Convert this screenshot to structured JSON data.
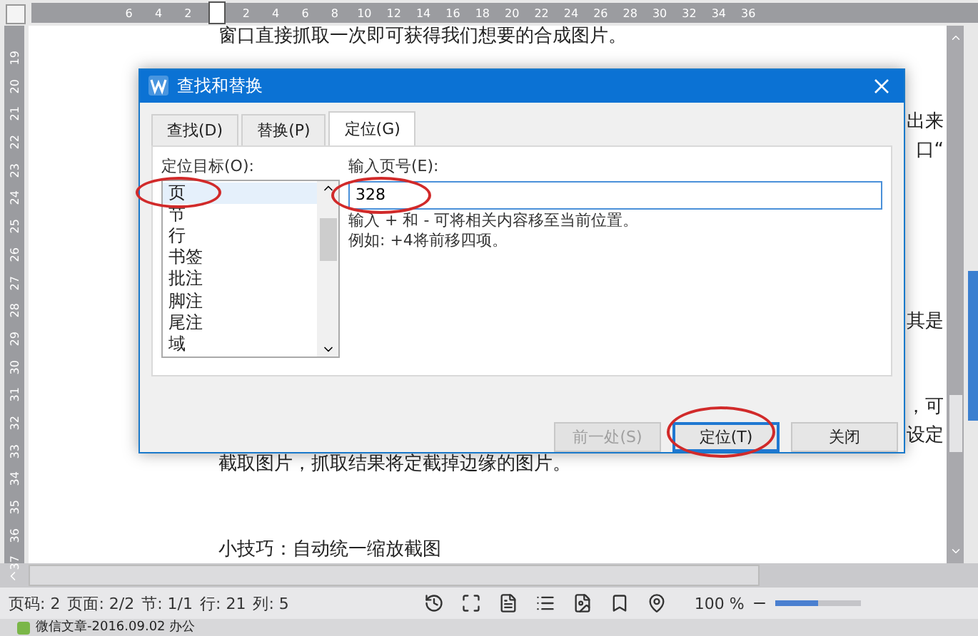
{
  "ruler": {
    "horizontal_ticks": [
      "6",
      "4",
      "2",
      "2",
      "4",
      "6",
      "8",
      "10",
      "12",
      "14",
      "16",
      "18",
      "20",
      "22",
      "24",
      "26",
      "28",
      "30",
      "32",
      "34",
      "36"
    ],
    "vertical_ticks": [
      "19",
      "20",
      "21",
      "22",
      "23",
      "24",
      "25",
      "26",
      "27",
      "28",
      "29",
      "30",
      "31",
      "32",
      "33",
      "34",
      "35",
      "36",
      "37"
    ]
  },
  "document": {
    "lines": [
      {
        "text": "窗口直接抓取一次即可获得我们想要的合成图片。",
        "kind": "body"
      },
      {
        "text": "出来",
        "kind": "fragment"
      },
      {
        "text": "口“",
        "kind": "fragment"
      },
      {
        "text": "其是",
        "kind": "fragment"
      },
      {
        "text": "，可",
        "kind": "fragment"
      },
      {
        "text": "设定",
        "kind": "fragment"
      },
      {
        "text": "截取图片，抓取结果将定截掉边缘的图片。",
        "kind": "body"
      },
      {
        "text": "小技巧：自动统一缩放截图",
        "kind": "body"
      }
    ]
  },
  "dialog": {
    "title": "查找和替换",
    "tabs": [
      {
        "label": "查找(D)",
        "selected": false
      },
      {
        "label": "替换(P)",
        "selected": false
      },
      {
        "label": "定位(G)",
        "selected": true
      }
    ],
    "target_label": "定位目标(O):",
    "targets": [
      {
        "label": "页",
        "selected": true
      },
      {
        "label": "节",
        "selected": false
      },
      {
        "label": "行",
        "selected": false
      },
      {
        "label": "书签",
        "selected": false
      },
      {
        "label": "批注",
        "selected": false
      },
      {
        "label": "脚注",
        "selected": false
      },
      {
        "label": "尾注",
        "selected": false
      },
      {
        "label": "域",
        "selected": false
      }
    ],
    "page_label": "输入页号(E):",
    "page_input": {
      "value": "328"
    },
    "hint_lines": [
      "输入 + 和 - 可将相关内容移至当前位置。",
      "例如: +4将前移四项。"
    ],
    "buttons": [
      {
        "label": "前一处(S)",
        "disabled": true,
        "default": false
      },
      {
        "label": "定位(T)",
        "disabled": false,
        "default": true
      },
      {
        "label": "关闭",
        "disabled": false,
        "default": false
      }
    ]
  },
  "status_bar": {
    "items": [
      "页码: 2",
      "页面: 2/2",
      "节: 1/1",
      "行: 21",
      "列: 5"
    ],
    "zoom": "100 %",
    "zoom_slider": {
      "level": 0.5
    }
  },
  "taskbar": {
    "title": "微信文章-2016.09.02 办公"
  }
}
